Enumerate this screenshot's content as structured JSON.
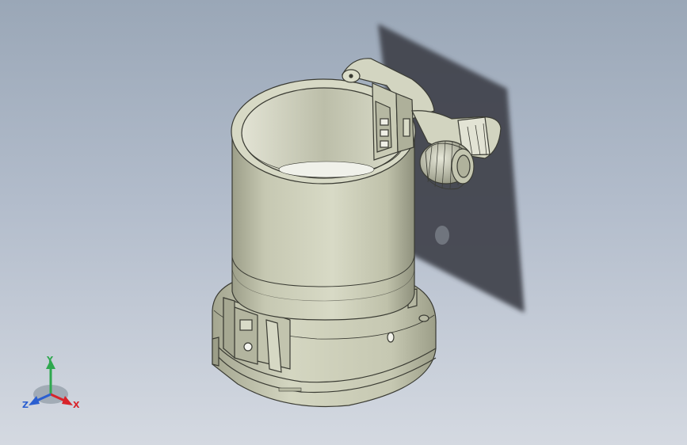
{
  "view": {
    "background_top": "#9aa7b7",
    "background_bottom": "#d4d9e1",
    "part_color": "#cfd1bb",
    "shadow_color": "#3f434b"
  },
  "triad": {
    "x_label": "X",
    "y_label": "Y",
    "z_label": "Z",
    "x_color": "#d8232a",
    "y_color": "#2fa84f",
    "z_color": "#2b5fd0"
  }
}
